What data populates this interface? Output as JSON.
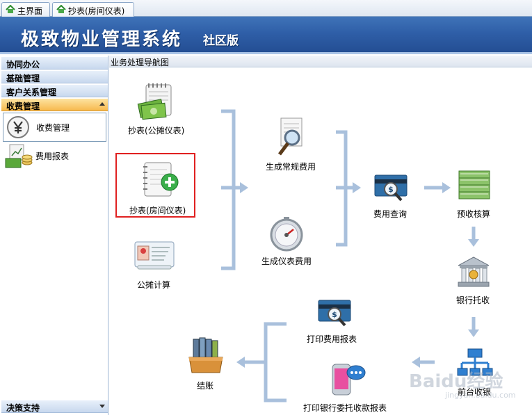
{
  "tabs": [
    {
      "label": "主界面",
      "icon": "home-icon"
    },
    {
      "label": "抄表(房间仪表)",
      "icon": "home-icon"
    }
  ],
  "banner": {
    "title": "极致物业管理系统",
    "edition": "社区版"
  },
  "sidebar": {
    "groups": [
      "协同办公",
      "基础管理",
      "客户关系管理",
      "收费管理"
    ],
    "active_group": "收费管理",
    "items": [
      {
        "label": "收费管理",
        "icon": "yen-icon"
      },
      {
        "label": "费用报表",
        "icon": "report-icon"
      }
    ],
    "footer": "决策支持"
  },
  "main": {
    "title": "业务处理导航图",
    "nodes": {
      "meter_shared": "抄表(公摊仪表)",
      "meter_room": "抄表(房间仪表)",
      "share_calc": "公摊计算",
      "gen_regular": "生成常规费用",
      "gen_meter": "生成仪表费用",
      "fee_query": "费用查询",
      "prepay_check": "预收核算",
      "bank_entrust": "银行托收",
      "front_cashier": "前台收银",
      "print_fee_report": "打印费用报表",
      "print_bank_report": "打印银行委托收款报表",
      "checkout": "结账"
    },
    "highlighted_node": "抄表(房间仪表)"
  },
  "watermark": {
    "brand": "Baidu经验",
    "url": "jingyan.baidu.com"
  },
  "colors": {
    "banner": "#2f5fa8",
    "accent_orange": "#f7b94e",
    "connector": "#a9c0dc",
    "highlight": "#e02020"
  }
}
